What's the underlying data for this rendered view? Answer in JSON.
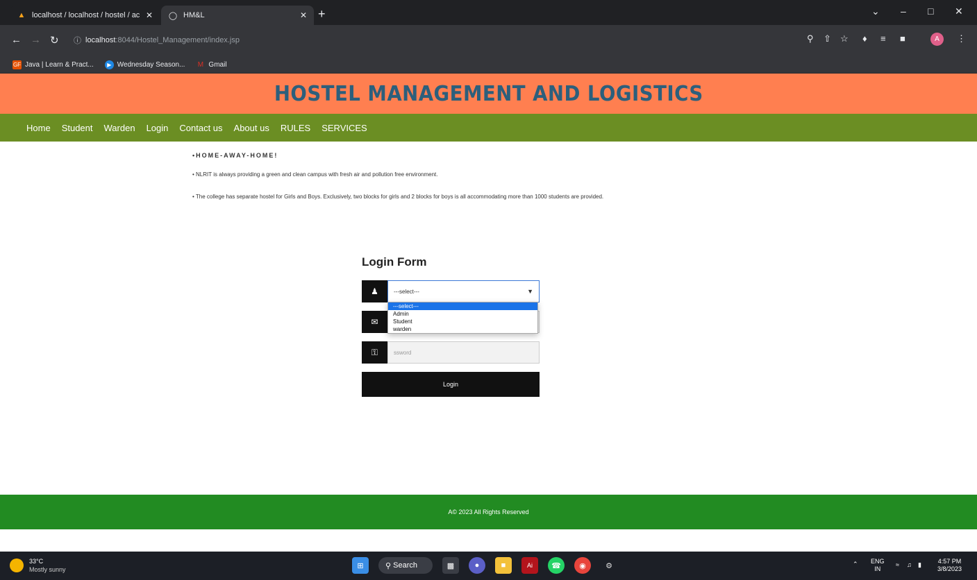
{
  "browser": {
    "tabs": [
      {
        "title": "localhost / localhost / hostel / ac",
        "active": false
      },
      {
        "title": "HM&L",
        "active": true
      }
    ],
    "url_host": "localhost",
    "url_path": ":8044/Hostel_Management/index.jsp",
    "bookmarks": [
      {
        "label": "Java | Learn & Pract...",
        "color": "#e65100"
      },
      {
        "label": "Wednesday Season...",
        "color": "#1e88e5"
      },
      {
        "label": "Gmail",
        "color": "#d93025"
      }
    ]
  },
  "site": {
    "title": "HOSTEL MANAGEMENT AND LOGISTICS",
    "nav": [
      "Home",
      "Student",
      "Warden",
      "Login",
      "Contact us",
      "About us",
      "RULES",
      "SERVICES"
    ],
    "intro_heading": "•HOME-AWAY-HOME!",
    "intro_lines": [
      "• NLRIT is always providing a green and clean campus with fresh air and pollution free environment.",
      "• The college has separate hostel for Girls and Boys. Exclusively, two blocks for girls and 2 blocks for boys is all accommodating more than 1000 students are provided."
    ],
    "login": {
      "heading": "Login Form",
      "role_selected": "---select---",
      "role_options": [
        "---select---",
        "Admin",
        "Student",
        "warden"
      ],
      "password_placeholder": "ssword",
      "button_label": "Login"
    },
    "footer": "A© 2023 All Rights Reserved",
    "colors": {
      "banner": "#ff7f50",
      "title": "#2c5f7c",
      "nav": "#6b8e23",
      "footer": "#228b22"
    }
  },
  "taskbar": {
    "temperature": "33°C",
    "weather": "Mostly sunny",
    "search_label": "Search",
    "language": "ENG",
    "region": "IN",
    "time": "4:57 PM",
    "date": "3/8/2023"
  }
}
